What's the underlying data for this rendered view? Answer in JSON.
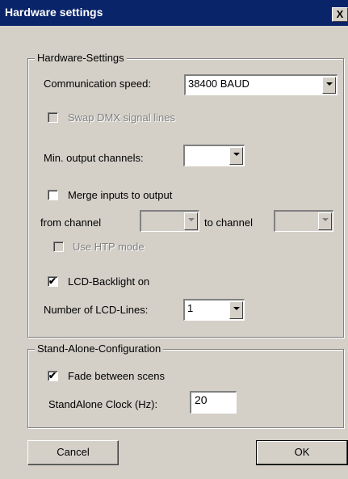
{
  "window": {
    "title": "Hardware settings",
    "close_glyph": "X"
  },
  "hardware_group": {
    "label": "Hardware-Settings",
    "communication_speed_label": "Communication speed:",
    "communication_speed_value": "38400 BAUD",
    "swap_dmx_label": "Swap DMX signal lines",
    "swap_dmx_checked": false,
    "min_output_label": "Min. output channels:",
    "min_output_value": "",
    "merge_inputs_label": "Merge inputs to output",
    "merge_inputs_checked": false,
    "from_channel_label": "from channel",
    "from_channel_value": "",
    "to_channel_label": "to channel",
    "to_channel_value": "",
    "use_htp_label": "Use HTP mode",
    "use_htp_checked": false,
    "lcd_backlight_label": "LCD-Backlight on",
    "lcd_backlight_checked": true,
    "lcd_lines_label": "Number of LCD-Lines:",
    "lcd_lines_value": "1"
  },
  "standalone_group": {
    "label": "Stand-Alone-Configuration",
    "fade_label": "Fade between scens",
    "fade_checked": true,
    "clock_label": "StandAlone Clock (Hz):",
    "clock_value": "20"
  },
  "buttons": {
    "cancel": "Cancel",
    "ok": "OK"
  },
  "icons": {
    "checkmark": "✔"
  }
}
